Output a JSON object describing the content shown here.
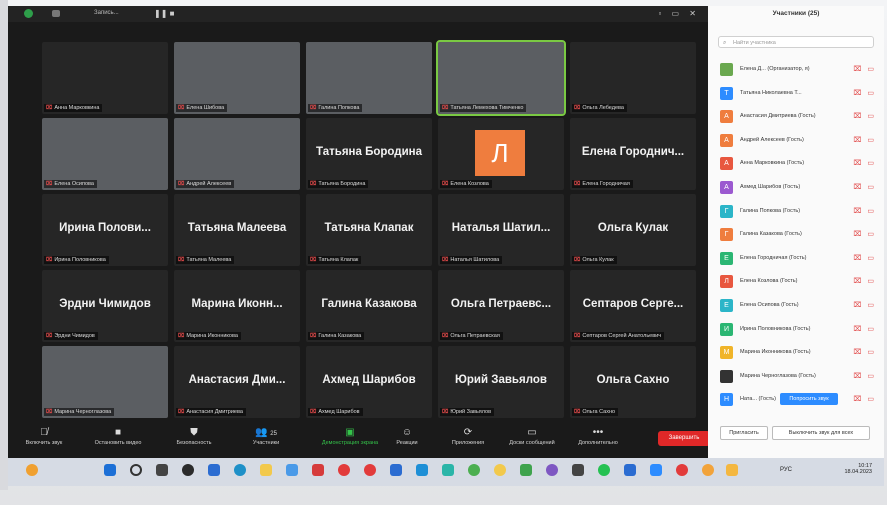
{
  "titlebar": {
    "recording": "Запись..."
  },
  "tiles": [
    {
      "label": "Анна Марковкина",
      "big": "",
      "video": false
    },
    {
      "label": "Елена Шибова",
      "big": "",
      "video": true
    },
    {
      "label": "Галина Попкова",
      "big": "",
      "video": true
    },
    {
      "label": "Татьяна Лемехова Тимченко",
      "big": "",
      "video": true,
      "active": true
    },
    {
      "label": "Ольга Лебедева",
      "big": "",
      "video": false
    },
    {
      "label": "Елена Осипова",
      "big": "",
      "video": true
    },
    {
      "label": "Андрей Алексеев",
      "big": "",
      "video": true
    },
    {
      "label": "Татьяна Бородина",
      "big": "Татьяна Бородина",
      "video": false
    },
    {
      "label": "Елена Козлова",
      "big": "",
      "video": false,
      "avatar": "Л"
    },
    {
      "label": "Елена Городничая",
      "big": "Елена Городнич...",
      "video": false
    },
    {
      "label": "Ирина Половникова",
      "big": "Ирина Полови...",
      "video": false
    },
    {
      "label": "Татьяна Малеева",
      "big": "Татьяна Малеева",
      "video": false
    },
    {
      "label": "Татьяна Клапак",
      "big": "Татьяна Клапак",
      "video": false
    },
    {
      "label": "Наталья Шатилова",
      "big": "Наталья Шатил...",
      "video": false
    },
    {
      "label": "Ольга Кулак",
      "big": "Ольга Кулак",
      "video": false
    },
    {
      "label": "Эрдни Чимидов",
      "big": "Эрдни Чимидов",
      "video": false
    },
    {
      "label": "Марина Иконникова",
      "big": "Марина Иконн...",
      "video": false
    },
    {
      "label": "Галина Казакова",
      "big": "Галина Казакова",
      "video": false
    },
    {
      "label": "Ольга Петраевская",
      "big": "Ольга Петраевс...",
      "video": false
    },
    {
      "label": "Септаров Сергей Анатольевич",
      "big": "Септаров Серге...",
      "video": false
    },
    {
      "label": "Марина Черноглазова",
      "big": "",
      "video": true
    },
    {
      "label": "Анастасия Дмитриева",
      "big": "Анастасия Дми...",
      "video": false
    },
    {
      "label": "Ахмед Шарибов",
      "big": "Ахмед Шарибов",
      "video": false
    },
    {
      "label": "Юрий Завьялов",
      "big": "Юрий Завьялов",
      "video": false
    },
    {
      "label": "Ольга Сахно",
      "big": "Ольга Сахно",
      "video": false
    }
  ],
  "toolbar": {
    "mute": "Включить звук",
    "video": "Остановить видео",
    "security": "Безопасность",
    "participants": "Участники",
    "participants_count": "25",
    "share": "Демонстрация экрана",
    "reactions": "Реакции",
    "apps": "Приложения",
    "whiteboard": "Доски сообщений",
    "more": "Дополнительно",
    "end": "Завершить"
  },
  "panel": {
    "title": "Участники (25)",
    "search_placeholder": "Найти участника",
    "participants": [
      {
        "name": "Елена Д... (Организатор, я)",
        "initial": "",
        "color": "#6aa84f"
      },
      {
        "name": "Татьяна Николаевна Т...",
        "initial": "Т",
        "color": "#2d8cff"
      },
      {
        "name": "Анастасия Дмитриева (Гость)",
        "initial": "А",
        "color": "#ef7d3e"
      },
      {
        "name": "Андрей Алексеев (Гость)",
        "initial": "А",
        "color": "#ef7d3e"
      },
      {
        "name": "Анна Марковкина (Гость)",
        "initial": "А",
        "color": "#e8573f"
      },
      {
        "name": "Ахмед Шарибов (Гость)",
        "initial": "А",
        "color": "#9b59d0"
      },
      {
        "name": "Галина Попкова (Гость)",
        "initial": "Г",
        "color": "#2bb5c8"
      },
      {
        "name": "Галина Казакова (Гость)",
        "initial": "Г",
        "color": "#ef7d3e"
      },
      {
        "name": "Елена Городничая (Гость)",
        "initial": "Е",
        "color": "#2bb673"
      },
      {
        "name": "Елена Козлова (Гость)",
        "initial": "Л",
        "color": "#e8573f"
      },
      {
        "name": "Елена Осипова (Гость)",
        "initial": "Е",
        "color": "#2bb5c8"
      },
      {
        "name": "Ирина Половникова (Гость)",
        "initial": "И",
        "color": "#2bb673"
      },
      {
        "name": "Марина Иконникова (Гость)",
        "initial": "М",
        "color": "#f0b429"
      },
      {
        "name": "Марина Черноглазова (Гость)",
        "initial": "",
        "color": "#333333"
      },
      {
        "name": "Ната...  (Гость)",
        "initial": "Н",
        "color": "#2d8cff",
        "ask": "Попросить звук"
      }
    ],
    "invite": "Пригласить",
    "mute_all": "Выключить звук для всех"
  },
  "tray": {
    "lang": "РУС",
    "time": "10:17",
    "date": "18.04.2023"
  }
}
